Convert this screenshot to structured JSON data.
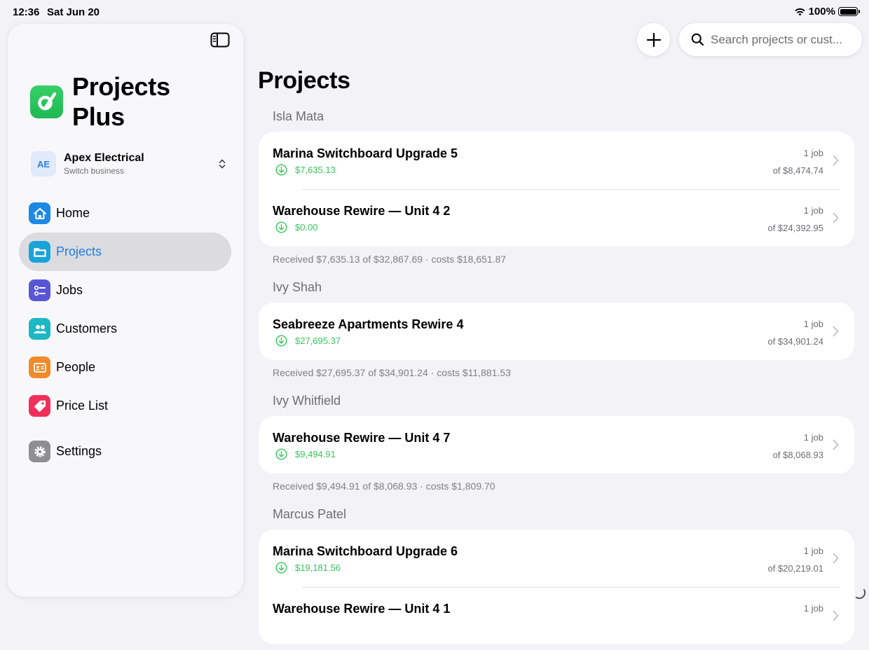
{
  "status": {
    "time": "12:36",
    "date": "Sat Jun 20",
    "battery": "100%"
  },
  "sidebar": {
    "app_title": "Projects Plus",
    "business": {
      "initials": "AE",
      "name": "Apex Electrical",
      "subtitle": "Switch business"
    },
    "items": [
      {
        "label": "Home",
        "icon": "house-icon",
        "color": "#1e88e5"
      },
      {
        "label": "Projects",
        "icon": "folder-icon",
        "color": "#1aa3d9",
        "active": true
      },
      {
        "label": "Jobs",
        "icon": "checklist-icon",
        "color": "#5856d6"
      },
      {
        "label": "Customers",
        "icon": "people-icon",
        "color": "#1cb8c4"
      },
      {
        "label": "People",
        "icon": "id-card-icon",
        "color": "#f08a2a"
      },
      {
        "label": "Price List",
        "icon": "tag-icon",
        "color": "#f0305a"
      },
      {
        "label": "Settings",
        "icon": "gear-icon",
        "color": "#8e8e93"
      }
    ]
  },
  "toolbar": {
    "search_placeholder": "Search projects or cust..."
  },
  "main": {
    "title": "Projects",
    "groups": [
      {
        "customer": "Isla Mata",
        "projects": [
          {
            "name": "Marina Switchboard Upgrade 5",
            "received": "$7,635.13",
            "jobs": "1 job",
            "total": "of $8,474.74"
          },
          {
            "name": "Warehouse Rewire — Unit 4 2",
            "received": "$0.00",
            "jobs": "1 job",
            "total": "of $24,392.95"
          }
        ],
        "summary": "Received $7,635.13 of $32,867.69 · costs $18,651.87"
      },
      {
        "customer": "Ivy Shah",
        "projects": [
          {
            "name": "Seabreeze Apartments Rewire 4",
            "received": "$27,695.37",
            "jobs": "1 job",
            "total": "of $34,901.24"
          }
        ],
        "summary": "Received $27,695.37 of $34,901.24 · costs $11,881.53"
      },
      {
        "customer": "Ivy Whitfield",
        "projects": [
          {
            "name": "Warehouse Rewire — Unit 4 7",
            "received": "$9,494.91",
            "jobs": "1 job",
            "total": "of $8,068.93"
          }
        ],
        "summary": "Received $9,494.91 of $8,068.93 · costs $1,809.70"
      },
      {
        "customer": "Marcus Patel",
        "projects": [
          {
            "name": "Marina Switchboard Upgrade 6",
            "received": "$19,181.56",
            "jobs": "1 job",
            "total": "of $20,219.01"
          },
          {
            "name": "Warehouse Rewire — Unit 4 1",
            "received": "",
            "jobs": "1 job",
            "total": ""
          }
        ],
        "summary": ""
      }
    ]
  }
}
